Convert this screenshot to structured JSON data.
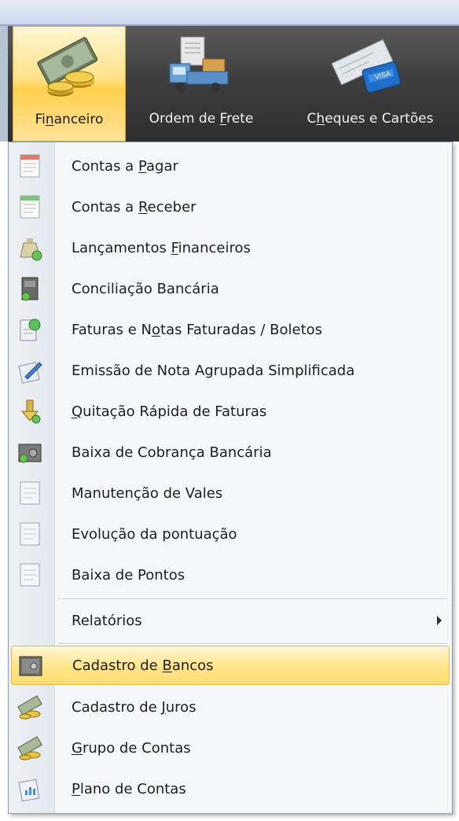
{
  "ribbon": {
    "buttons": [
      {
        "label_before": "Fi",
        "label_mnemonic": "n",
        "label_after": "anceiro",
        "icon": "money-coins-icon",
        "active": true
      },
      {
        "label_before": "Ordem de ",
        "label_mnemonic": "F",
        "label_after": "rete",
        "icon": "truck-icon",
        "active": false
      },
      {
        "label_before": "C",
        "label_mnemonic": "h",
        "label_after": "eques e Cartões",
        "icon": "cheque-card-icon",
        "active": false
      }
    ]
  },
  "menu": {
    "items": [
      {
        "before": "Contas a ",
        "mnemonic": "P",
        "after": "agar",
        "icon": "document-red-icon"
      },
      {
        "before": "Contas a ",
        "mnemonic": "R",
        "after": "eceber",
        "icon": "document-green-icon"
      },
      {
        "before": "Lançamentos ",
        "mnemonic": "F",
        "after": "inanceiros",
        "icon": "money-bag-icon"
      },
      {
        "before": "Conciliação Bancária",
        "mnemonic": "",
        "after": "",
        "icon": "safe-box-icon"
      },
      {
        "before": "Faturas e N",
        "mnemonic": "o",
        "after": "tas Faturadas / Boletos",
        "icon": "invoice-globe-icon"
      },
      {
        "before": "Emissão de Nota Agrupada Simplificada",
        "mnemonic": "",
        "after": "",
        "icon": "pen-document-icon"
      },
      {
        "before": "",
        "mnemonic": "Q",
        "after": "uitação Rápida de Faturas",
        "icon": "download-arrow-icon"
      },
      {
        "before": "Baixa de Cobrança Bancária",
        "mnemonic": "",
        "after": "",
        "icon": "vault-icon"
      },
      {
        "before": "Manutenção de Vales",
        "mnemonic": "",
        "after": "",
        "icon": "document-blank-icon"
      },
      {
        "before": "Evolução da pontuação",
        "mnemonic": "",
        "after": "",
        "icon": "document-blank-icon"
      },
      {
        "before": "Baixa de Pontos",
        "mnemonic": "",
        "after": "",
        "icon": "document-blank-icon"
      },
      {
        "before": "Relatórios",
        "mnemonic": "",
        "after": "",
        "icon": "",
        "submenu": true
      },
      {
        "before": "Cadastro de ",
        "mnemonic": "B",
        "after": "ancos",
        "icon": "safe-icon",
        "highlighted": true
      },
      {
        "before": "Cadastro de ",
        "mnemonic": "J",
        "after": "uros",
        "icon": "money-stack-icon"
      },
      {
        "before": "",
        "mnemonic": "G",
        "after": "rupo de Contas",
        "icon": "money-stack-icon"
      },
      {
        "before": "",
        "mnemonic": "P",
        "after": "lano de Contas",
        "icon": "chart-document-icon"
      }
    ]
  },
  "colors": {
    "ribbon_dark": "#3e3e3e",
    "active_gold": "#ffd04e",
    "highlight": "#ffe488",
    "menu_bg": "#f6f7f9"
  }
}
